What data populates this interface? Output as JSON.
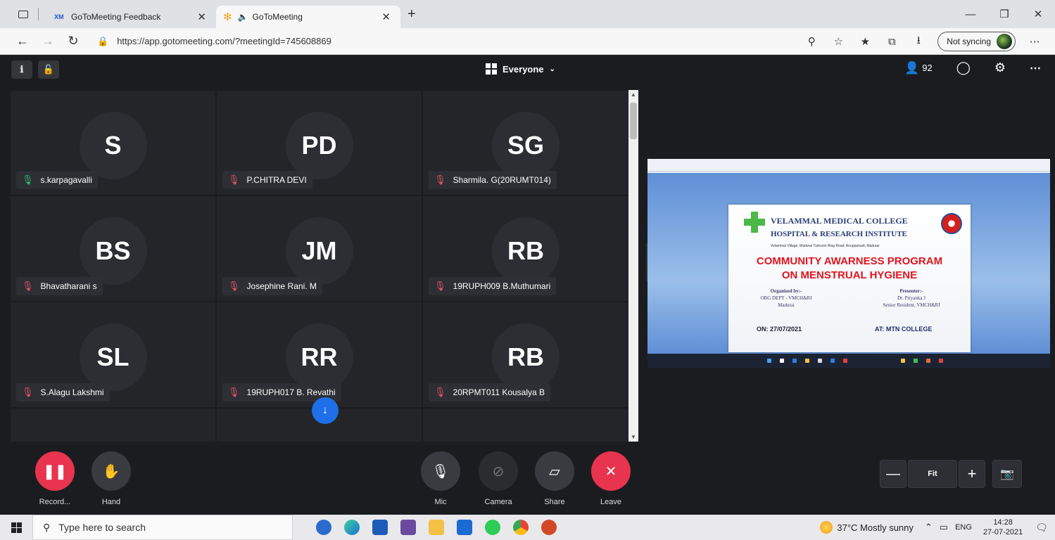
{
  "browser": {
    "tabs": [
      {
        "label": "GoToMeeting Feedback",
        "favicon": "XM"
      },
      {
        "label": "GoToMeeting",
        "favicon": "gotomeeting-flower"
      }
    ],
    "url": "https://app.gotomeeting.com/?meetingId=745608869",
    "sync_label": "Not syncing"
  },
  "meeting": {
    "view_selector": "Everyone",
    "participant_count": "92",
    "participants": [
      {
        "initials": "S",
        "name": "s.karpagavalli",
        "mic": "on"
      },
      {
        "initials": "PD",
        "name": "P.CHITRA DEVI",
        "mic": "muted"
      },
      {
        "initials": "SG",
        "name": "Sharmila. G(20RUMT014)",
        "mic": "muted"
      },
      {
        "initials": "BS",
        "name": "Bhavatharani s",
        "mic": "muted"
      },
      {
        "initials": "JM",
        "name": "Josephine Rani. M",
        "mic": "muted"
      },
      {
        "initials": "RB",
        "name": "19RUPH009 B.Muthumari",
        "mic": "muted"
      },
      {
        "initials": "SL",
        "name": "S.Alagu Lakshmi",
        "mic": "muted"
      },
      {
        "initials": "RR",
        "name": "19RUPH017 B. Revathi",
        "mic": "muted"
      },
      {
        "initials": "RB",
        "name": "20RPMT011 Kousalya B",
        "mic": "muted"
      }
    ],
    "slide": {
      "college_line1": "VELAMMAL MEDICAL COLLEGE",
      "college_line2": "HOSPITAL & RESEARCH INSTITUTE",
      "address": "Velammal Village, Madurai Tuticorin Ring Road, Anuppanadi, Madurai",
      "headline1": "COMMUNITY AWARNESS PROGRAM",
      "headline2": "ON MENSTRUAL HYGIENE",
      "organised_by": [
        "Organised by:-",
        "OBG DEPT - VMCH&RI",
        "Madurai"
      ],
      "presenter": [
        "Presenter:-",
        "Dr. Priyanka J",
        "Senior Resident, VMCH&RI"
      ],
      "date": "ON: 27/07/2021",
      "venue": "AT: MTN COLLEGE"
    },
    "controls": {
      "record": "Record...",
      "hand": "Hand",
      "mic": "Mic",
      "camera": "Camera",
      "share": "Share",
      "leave": "Leave",
      "fit": "Fit"
    }
  },
  "taskbar": {
    "search_placeholder": "Type here to search",
    "weather": "37°C  Mostly sunny",
    "lang": "ENG",
    "time": "14:28",
    "date": "27-07-2021"
  },
  "colors": {
    "record": "#e8344e",
    "leave": "#e8344e",
    "accent_blue": "#1e6fe8",
    "muted_mic": "#e85563",
    "active_mic": "#27c26c"
  }
}
